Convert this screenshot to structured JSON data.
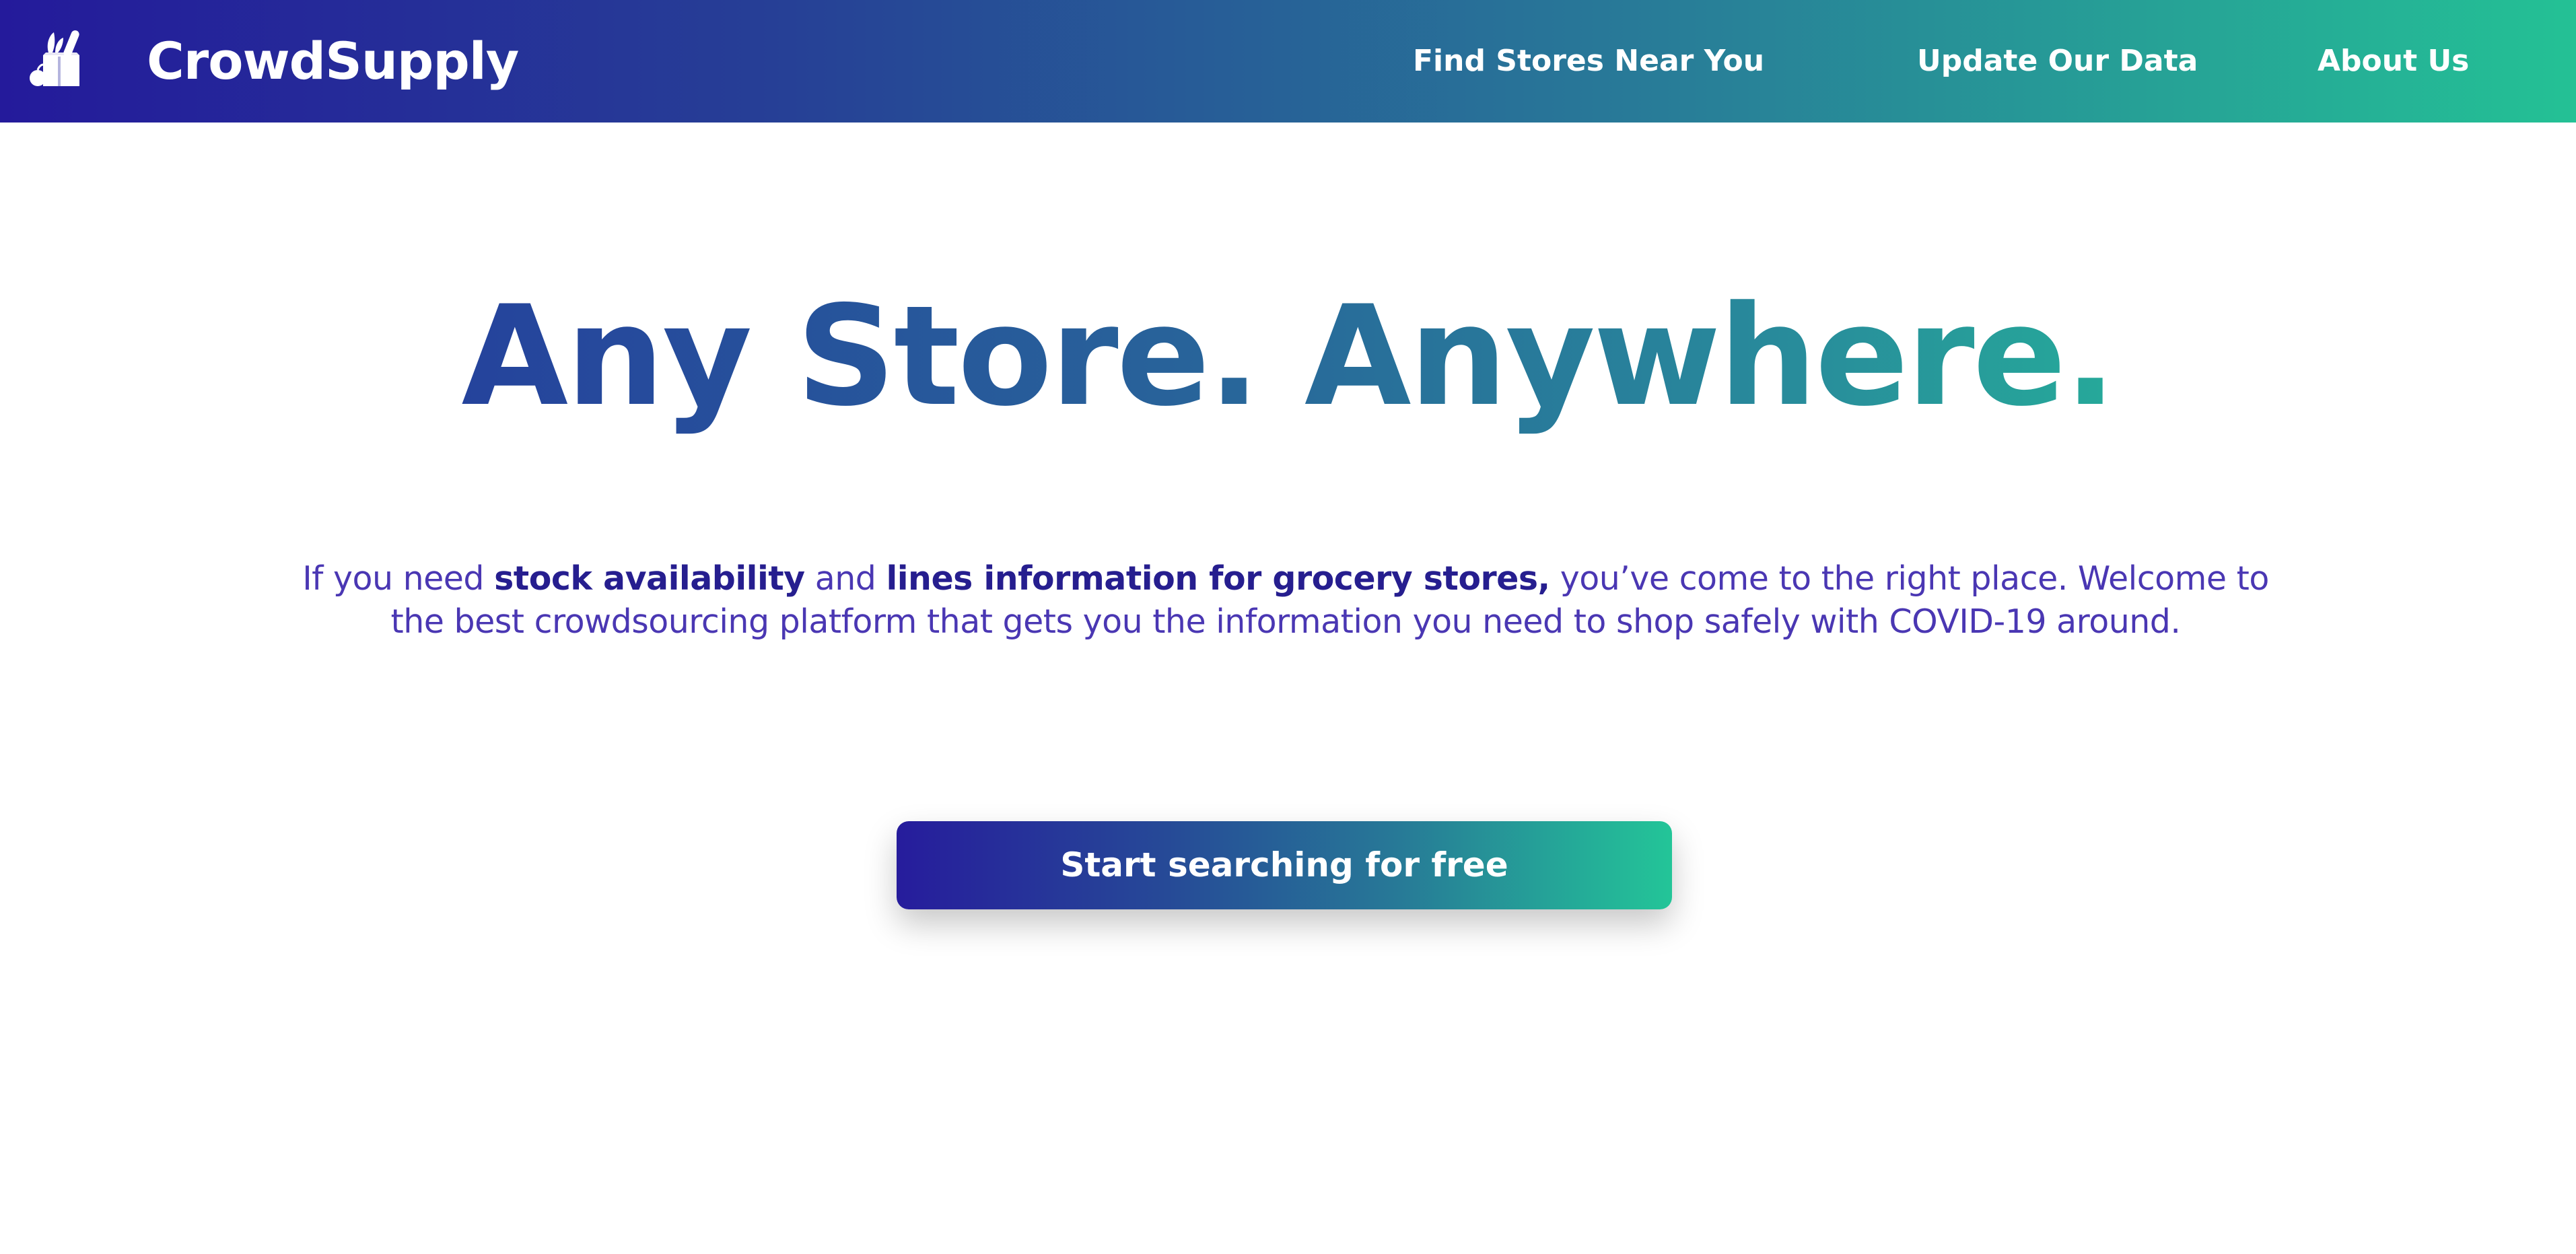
{
  "app": {
    "brand_name": "CrowdSupply",
    "logo_icon": "grocery-bag-icon"
  },
  "nav": {
    "items": [
      {
        "label": "Find Stores Near You"
      },
      {
        "label": "Update Our Data"
      },
      {
        "label": "About Us"
      }
    ]
  },
  "hero": {
    "title": "Any Store. Anywhere.",
    "description": {
      "part1": "If you need ",
      "bold1": "stock availability",
      "part2": " and ",
      "bold2": "lines information for grocery stores,",
      "part3": " you’ve come to the right place. Welcome to the best crowdsourcing platform that gets you the information you need to shop safely with COVID-19 around."
    },
    "cta_label": "Start searching for free"
  },
  "colors": {
    "gradient_start": "#241a9b",
    "gradient_end": "#24c195",
    "body_text": "#4a37b3",
    "bold_text": "#261e8f"
  }
}
